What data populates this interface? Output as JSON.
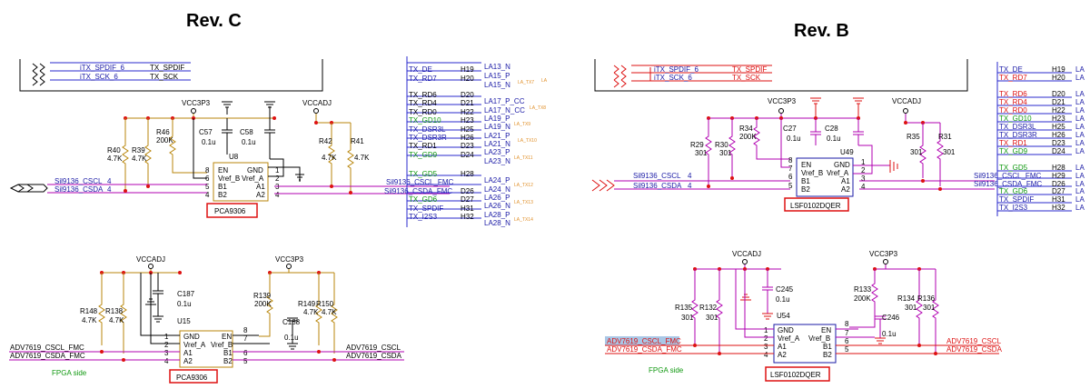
{
  "headers": {
    "rev_c": "Rev. C",
    "rev_b": "Rev. B"
  },
  "rev_c": {
    "top": {
      "nets": [
        "iTX_SPDIF_6",
        "TX_SPDIF",
        "iTX_SCK_6",
        "TX_SCK"
      ],
      "chip_label": "PCA9306",
      "chip_ref": "U8",
      "pins_left": [
        {
          "num": "8",
          "name": "EN"
        },
        {
          "num": "6",
          "name": "Vref_B"
        },
        {
          "num": "5",
          "name": "B1"
        },
        {
          "num": "4",
          "name": "B2"
        }
      ],
      "pins_right": [
        {
          "num": "1",
          "name": "GND"
        },
        {
          "num": "2",
          "name": "Vref_A"
        },
        {
          "num": "3",
          "name": "A1"
        },
        {
          "num": "4",
          "name": "A2"
        }
      ],
      "supplies": [
        "VCC3P3",
        "VCCADJ"
      ],
      "resistors": [
        {
          "ref": "R46",
          "val": "200K"
        },
        {
          "ref": "R40",
          "val": "4.7K"
        },
        {
          "ref": "R39",
          "val": "4.7K"
        },
        {
          "ref": "R42",
          "val": "4.7K"
        },
        {
          "ref": "R41",
          "val": "4.7K"
        }
      ],
      "caps": [
        {
          "ref": "C57",
          "val": "0.1u"
        },
        {
          "ref": "C58",
          "val": "0.1u"
        }
      ],
      "in_nets": [
        "Sil9136_CSCL",
        "4",
        "Sil9136_CSDA",
        "4"
      ],
      "out_nets": [
        "Sil9136_CSCL_FMC",
        "Sil9136_CSDA_FMC"
      ]
    },
    "bottom": {
      "chip_label": "PCA9306",
      "chip_ref": "U15",
      "pins_left": [
        {
          "num": "1",
          "name": "GND"
        },
        {
          "num": "2",
          "name": "Vref_A"
        },
        {
          "num": "3",
          "name": "A1"
        },
        {
          "num": "4",
          "name": "A2"
        }
      ],
      "pins_right": [
        {
          "num": "8",
          "name": "EN"
        },
        {
          "num": "7",
          "name": "Vref_B"
        },
        {
          "num": "6",
          "name": "B1"
        },
        {
          "num": "5",
          "name": "B2"
        }
      ],
      "supplies": [
        "VCCADJ",
        "VCC3P3"
      ],
      "resistors": [
        {
          "ref": "R148",
          "val": "4.7K"
        },
        {
          "ref": "R138",
          "val": "4.7K"
        },
        {
          "ref": "R139",
          "val": "200K"
        },
        {
          "ref": "R149",
          "val": "4.7K"
        },
        {
          "ref": "R150",
          "val": "4.7K"
        }
      ],
      "caps": [
        {
          "ref": "C187",
          "val": "0.1u"
        },
        {
          "ref": "C188",
          "val": "0.1u"
        }
      ],
      "left_nets": [
        "ADV7619_CSCL_FMC",
        "ADV7619_CSDA_FMC"
      ],
      "right_nets": [
        "ADV7619_CSCL",
        "ADV7619_CSDA"
      ],
      "side_note": "FPGA side"
    },
    "connector": {
      "nets": [
        "TX_DE",
        "TX_RD7",
        "TX_RD6",
        "TX_RD4",
        "TX_RD0",
        "TX_GD10",
        "TX_GD6",
        "TX_DSR3L",
        "TX_DSR3R",
        "TX_RD1",
        "TX_GD9",
        "TX_GD5",
        "TX_GD6",
        "TX_SPDIF",
        "TX_I2S3"
      ],
      "pins": [
        "H19",
        "H20",
        "D20",
        "D21",
        "H22",
        "H23",
        "H25",
        "H26",
        "D23",
        "D24",
        "H28",
        "D26",
        "D27",
        "H31",
        "H32"
      ],
      "la": [
        "LA13_N",
        "LA15_P",
        "LA15_N",
        "LA17_P_CC",
        "LA17_N_CC",
        "LA19_P",
        "LA19_N",
        "LA21_P",
        "LA21_N",
        "LA23_P",
        "LA23_N",
        "LA24_P",
        "LA24_N",
        "LA26_P",
        "LA26_N",
        "LA28_P",
        "LA28_N"
      ],
      "tx": [
        "LA_TX7",
        "LA_TX8",
        "LA_TX9",
        "LA_TX10",
        "LA_TX11",
        "LA_TX12",
        "LA_TX13",
        "LA_TX14",
        "LA"
      ]
    }
  },
  "rev_b": {
    "top": {
      "nets": [
        "iTX_SPDIF_6",
        "TX_SPDIF",
        "iTX_SCK_6",
        "TX_SCK"
      ],
      "chip_label": "LSF0102DQER",
      "chip_ref": "U49",
      "pins_left": [
        {
          "num": "8",
          "name": "EN"
        },
        {
          "num": "7",
          "name": "Vref_B"
        },
        {
          "num": "6",
          "name": "B1"
        },
        {
          "num": "5",
          "name": "B2"
        }
      ],
      "pins_right": [
        {
          "num": "1",
          "name": "GND"
        },
        {
          "num": "2",
          "name": "Vref_A"
        },
        {
          "num": "3",
          "name": "A1"
        },
        {
          "num": "4",
          "name": "A2"
        }
      ],
      "supplies": [
        "VCC3P3",
        "VCCADJ"
      ],
      "resistors": [
        {
          "ref": "R34",
          "val": "200K"
        },
        {
          "ref": "R29",
          "val": "301"
        },
        {
          "ref": "R30",
          "val": "301"
        },
        {
          "ref": "R35",
          "val": "301"
        },
        {
          "ref": "R31",
          "val": "301"
        }
      ],
      "caps": [
        {
          "ref": "C27",
          "val": "0.1u"
        },
        {
          "ref": "C28",
          "val": "0.1u"
        }
      ],
      "in_nets": [
        "Sil9136_CSCL",
        "4",
        "Sil9136_CSDA",
        "4"
      ],
      "out_nets": [
        "Sil9136_CSCL_FMC",
        "Sil9136_CSDA_FMC"
      ]
    },
    "bottom": {
      "chip_label": "LSF0102DQER",
      "chip_ref": "U54",
      "pins_left": [
        {
          "num": "1",
          "name": "GND"
        },
        {
          "num": "2",
          "name": "Vref_A"
        },
        {
          "num": "3",
          "name": "A1"
        },
        {
          "num": "4",
          "name": "A2"
        }
      ],
      "pins_right": [
        {
          "num": "8",
          "name": "EN"
        },
        {
          "num": "7",
          "name": "Vref_B"
        },
        {
          "num": "6",
          "name": "B1"
        },
        {
          "num": "5",
          "name": "B2"
        }
      ],
      "supplies": [
        "VCCADJ",
        "VCC3P3"
      ],
      "resistors": [
        {
          "ref": "R135",
          "val": "301"
        },
        {
          "ref": "R132",
          "val": "301"
        },
        {
          "ref": "R133",
          "val": "200K"
        },
        {
          "ref": "R134",
          "val": "301"
        },
        {
          "ref": "R136",
          "val": "301"
        }
      ],
      "caps": [
        {
          "ref": "C245",
          "val": "0.1u"
        },
        {
          "ref": "C246",
          "val": "0.1u"
        }
      ],
      "left_nets": [
        "ADV7619_CSCL_FMC",
        "ADV7619_CSDA_FMC"
      ],
      "right_nets": [
        "ADV7619_CSCL",
        "ADV7619_CSDA"
      ],
      "side_note": "FPGA side"
    },
    "connector": {
      "nets": [
        "TX_DE",
        "TX_RD7",
        "TX_RD6",
        "TX_RD4",
        "TX_RD0",
        "TX_GD10",
        "TX_DSR3L",
        "TX_DSR3R",
        "TX_RD1",
        "TX_GD9",
        "TX_GD5",
        "Sil9136_CSCL_FMC",
        "Sil9136_CSDA_FMC",
        "TX_GD6",
        "TX_SPDIF",
        "TX_I2S3"
      ],
      "pins": [
        "H19",
        "H20",
        "D20",
        "D21",
        "H22",
        "H23",
        "H25",
        "H26",
        "D23",
        "D24",
        "H28",
        "H29",
        "D26",
        "D27",
        "H31",
        "H32"
      ],
      "la": [
        "LA",
        "LA",
        "LA",
        "LA",
        "LA",
        "LA",
        "LA",
        "LA",
        "LA",
        "LA",
        "LA",
        "LA",
        "LA",
        "LA",
        "LA",
        "LA"
      ]
    }
  }
}
